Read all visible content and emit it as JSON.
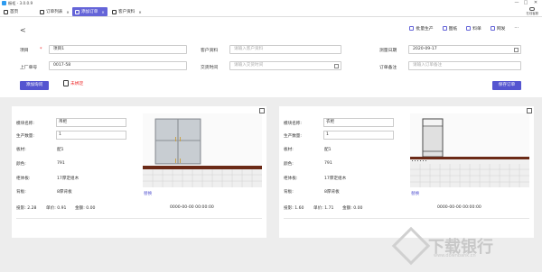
{
  "window": {
    "title": "橱柜 - 3.0.0.9",
    "minimize_glyph": "—",
    "maximize_glyph": "□",
    "close_glyph": "✕"
  },
  "nav": {
    "items": [
      {
        "label": "首页",
        "active": false
      },
      {
        "label": "订单列表",
        "active": false
      },
      {
        "label": "添加订单",
        "active": true
      },
      {
        "label": "客户资料",
        "active": false
      }
    ],
    "close_glyph": "×",
    "chat_label": "在线客服"
  },
  "toolbar": {
    "back_glyph": "<",
    "batch_produce": "批量生产",
    "drawing": "图纸",
    "materials": "料单",
    "share": "网发",
    "more": "···"
  },
  "form": {
    "project_label": "项目",
    "project_value": "项目1",
    "factory_no_label": "上厂单号",
    "factory_no_value": "0017-58",
    "customer_label": "客户资料",
    "customer_placeholder": "请输入客户资料",
    "delivery_label": "交货时间",
    "delivery_placeholder": "请输入交货时间",
    "measure_label": "测量日期",
    "measure_value": "2020-09-17",
    "remark_label": "订单备注",
    "remark_placeholder": "请输入订单备注"
  },
  "actions": {
    "add_measure": "添加询问",
    "unbind": "未绑定",
    "save_order": "保存订单"
  },
  "cards": [
    {
      "name_label": "模块名称:",
      "name_value": "吊柜",
      "qty_label": "生产数量:",
      "qty_value": "1",
      "board_label": "板材:",
      "board_value": "配1",
      "color_label": "颜色:",
      "color_value": "791",
      "edge_label": "柜体板:",
      "edge_value": "17厚定组木",
      "door_label": "背板:",
      "door_value": "8厚背板",
      "replace": "替换",
      "area": "投影: 2.28",
      "unit_area": "单价: 0.91",
      "amount": "金额: 0.00",
      "time": "0000-00-00 00:00:00"
    },
    {
      "name_label": "模块名称:",
      "name_value": "衣柜",
      "qty_label": "生产数量:",
      "qty_value": "1",
      "board_label": "板材:",
      "board_value": "配1",
      "color_label": "颜色:",
      "color_value": "791",
      "edge_label": "柜体板:",
      "edge_value": "17厚定组木",
      "door_label": "背板:",
      "door_value": "8厚背板",
      "replace": "替换",
      "area": "投影: 1.60",
      "unit_area": "单价: 1.71",
      "amount": "金额: 0.00",
      "time": "0000-00-00 00:00:00"
    }
  ],
  "watermark": {
    "text": "下载银行",
    "url": "www.downbank.cn"
  }
}
